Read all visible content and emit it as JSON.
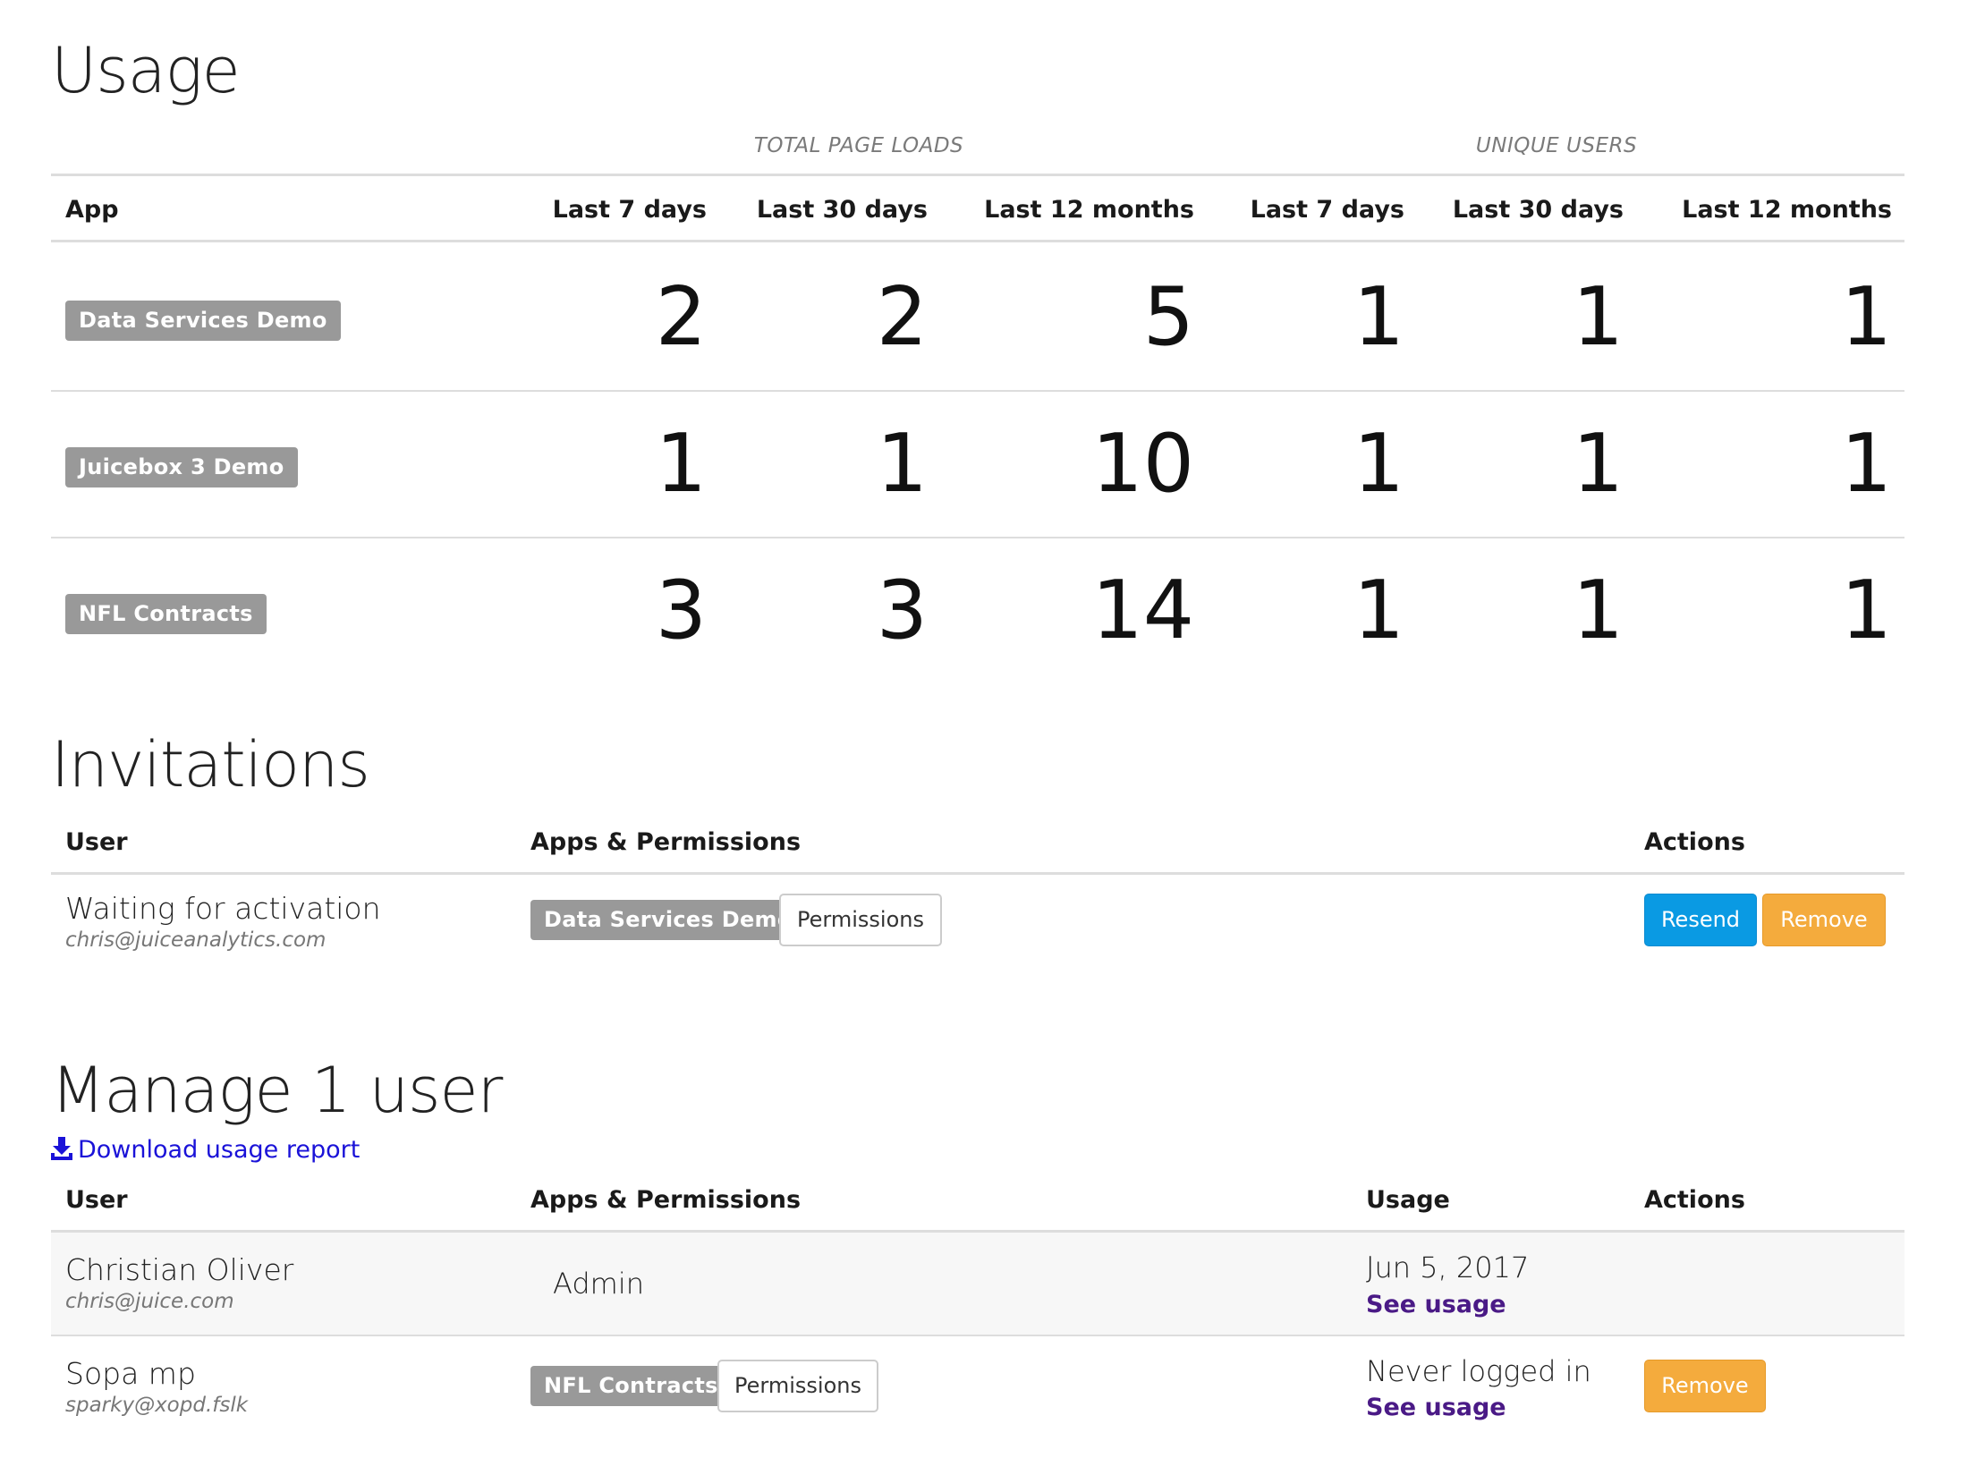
{
  "usage": {
    "title": "Usage",
    "group_labels": [
      "TOTAL PAGE LOADS",
      "UNIQUE USERS"
    ],
    "headers": [
      "App",
      "Last 7 days",
      "Last 30 days",
      "Last 12 months",
      "Last 7 days",
      "Last 30 days",
      "Last 12 months"
    ],
    "rows": [
      {
        "app": "Data Services Demo",
        "values": [
          "2",
          "2",
          "5",
          "1",
          "1",
          "1"
        ]
      },
      {
        "app": "Juicebox 3 Demo",
        "values": [
          "1",
          "1",
          "10",
          "1",
          "1",
          "1"
        ]
      },
      {
        "app": "NFL Contracts",
        "values": [
          "3",
          "3",
          "14",
          "1",
          "1",
          "1"
        ]
      }
    ]
  },
  "invitations": {
    "title": "Invitations",
    "headers": [
      "User",
      "Apps & Permissions",
      "Actions"
    ],
    "rows": [
      {
        "name": "Waiting for activation",
        "email": "chris@juiceanalytics.com",
        "app": "Data Services Demo",
        "permissions_label": "Permissions",
        "resend_label": "Resend",
        "remove_label": "Remove"
      }
    ]
  },
  "manage": {
    "title": "Manage 1 user",
    "download_label": "Download usage report",
    "headers": [
      "User",
      "Apps & Permissions",
      "Usage",
      "Actions"
    ],
    "rows": [
      {
        "name": "Christian Oliver",
        "email": "chris@juice.com",
        "role": "Admin",
        "usage": "Jun 5, 2017",
        "see_usage": "See usage"
      },
      {
        "name": "Sopa mp",
        "email": "sparky@xopd.fslk",
        "app": "NFL Contracts",
        "permissions_label": "Permissions",
        "usage": "Never logged in",
        "see_usage": "See usage",
        "remove_label": "Remove"
      }
    ]
  },
  "icons": {
    "download": "download-icon"
  },
  "colors": {
    "badge": "#999999",
    "resend": "#0a9ae3",
    "remove": "#f4ab3d",
    "link": "#1a12d8",
    "see_usage": "#4a1a86"
  }
}
